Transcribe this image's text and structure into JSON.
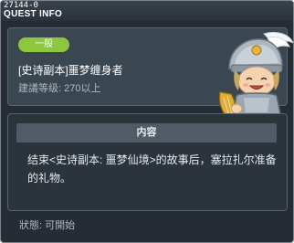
{
  "header": {
    "quest_id": "27144-0",
    "title": "QUEST INFO"
  },
  "quest": {
    "type_badge": "一般",
    "name": "[史诗副本]噩梦缠身者",
    "level_req": "建議等级: 270以上",
    "portrait_icon": "npc-knight-portrait"
  },
  "content": {
    "header": "内容",
    "text": "结束<史诗副本: 噩梦仙境>的故事后，塞拉扎尔准备的礼物。"
  },
  "status": {
    "text": "狀態: 可開始"
  },
  "colors": {
    "badge_green": "#8dc63f",
    "window_bg": "#252c33",
    "panel_bg": "#3b4750"
  }
}
